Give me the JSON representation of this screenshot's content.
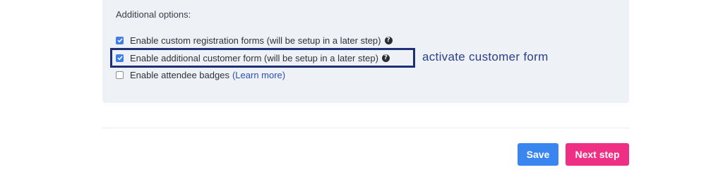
{
  "section_title": "Additional options:",
  "options": [
    {
      "label": "Enable custom registration forms (will be setup in a later step)",
      "checked": true,
      "help_icon": "question-circle-icon"
    },
    {
      "label": "Enable additional customer form (will be setup in a later step)",
      "checked": true,
      "help_icon": "question-circle-icon"
    },
    {
      "label": "Enable attendee badges",
      "checked": false,
      "link": "(Learn more)"
    }
  ],
  "help_glyph": "?",
  "annotation": "activate customer form",
  "buttons": {
    "save": "Save",
    "next": "Next step"
  },
  "colors": {
    "checkbox": "#3f7ee8",
    "save": "#3a86f0",
    "next": "#ee2f84",
    "highlight": "#1c2f78",
    "annotation": "#2b3f8c",
    "link": "#2a50b4"
  }
}
